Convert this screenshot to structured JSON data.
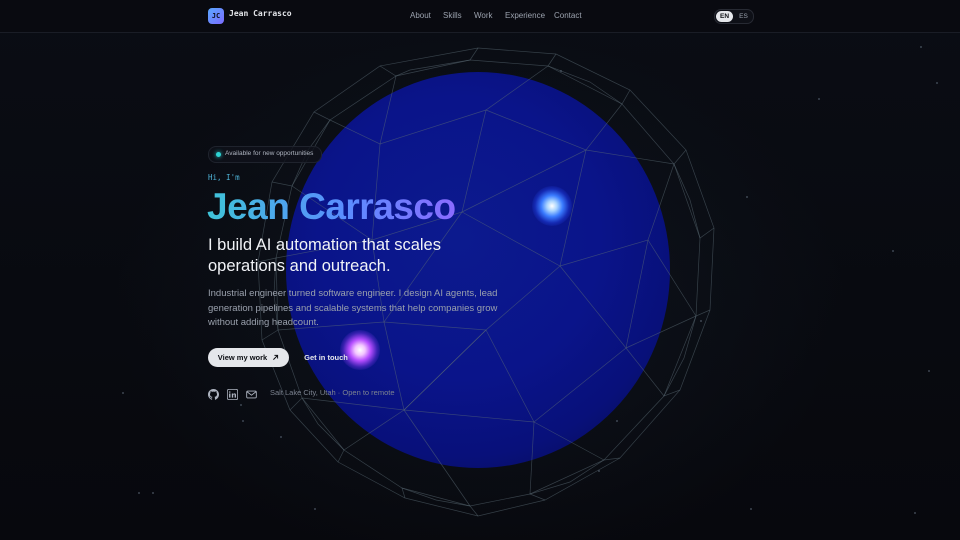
{
  "header": {
    "logo_initials": "JC",
    "logo_name": "Jean Carrasco",
    "nav": [
      {
        "label": "About"
      },
      {
        "label": "Skills"
      },
      {
        "label": "Work"
      },
      {
        "label": "Experience"
      },
      {
        "label": "Contact"
      }
    ],
    "lang": {
      "active": "EN",
      "inactive": "ES"
    }
  },
  "hero": {
    "status": "Available for new opportunities",
    "greeting": "Hi, I'm",
    "name": "Jean Carrasco",
    "headline": "I build AI automation that scales operations and outreach.",
    "description": "Industrial engineer turned software engineer. I design AI agents, lead generation pipelines and scalable systems that help companies grow without adding headcount.",
    "primary_cta": "View my work",
    "secondary_cta": "Get in touch",
    "location": "Salt Lake City, Utah · Open to remote",
    "social_icons": [
      "github-icon",
      "linkedin-icon",
      "mail-icon"
    ]
  },
  "colors": {
    "background": "#07080d",
    "globe": "#0a148a",
    "accent_cyan": "#3fc4d8",
    "accent_violet": "#8a6bff",
    "status_dot": "#2dd4d4"
  }
}
